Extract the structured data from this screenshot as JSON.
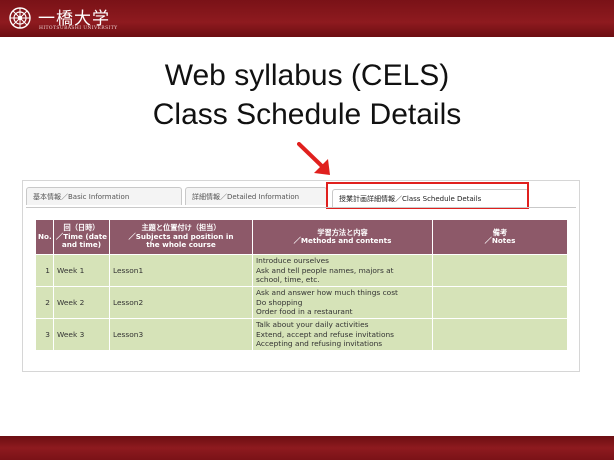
{
  "header": {
    "logo_jp": "一橋大学",
    "logo_en": "HITOTSUBASHI UNIVERSITY"
  },
  "title": {
    "line1": "Web syllabus (CELS)",
    "line2": "Class Schedule Details"
  },
  "tabs": [
    {
      "label": "基本情報／Basic Information",
      "active": false
    },
    {
      "label": "詳細情報／Detailed Information",
      "active": false
    },
    {
      "label": "授業計画詳細情報／Class Schedule Details",
      "active": true
    }
  ],
  "table": {
    "headers": {
      "no": "No.",
      "time": [
        "回（日時）",
        "／Time (date",
        "and time)"
      ],
      "subject": [
        "主題と位置付け（担当）",
        "／Subjects and position in",
        "the whole course"
      ],
      "methods": [
        "学習方法と内容",
        "／Methods and contents"
      ],
      "notes": [
        "備考",
        "／Notes"
      ]
    },
    "rows": [
      {
        "no": "1",
        "time": "Week 1",
        "subject": "Lesson1",
        "methods": [
          "Introduce ourselves",
          "Ask and tell people names, majors at",
          "school, time, etc."
        ],
        "notes": ""
      },
      {
        "no": "2",
        "time": "Week 2",
        "subject": "Lesson2",
        "methods": [
          "Ask and answer how much things cost",
          "Do shopping",
          "Order food in a restaurant"
        ],
        "notes": ""
      },
      {
        "no": "3",
        "time": "Week 3",
        "subject": "Lesson3",
        "methods": [
          "Talk about your daily activities",
          "Extend, accept and refuse invitations",
          "Accepting and refusing invitations"
        ],
        "notes": ""
      }
    ]
  },
  "colors": {
    "brand": "#8e1a1f",
    "header_cell": "#8d5969",
    "body_cell": "#d6e3b8",
    "highlight": "#e0201e"
  },
  "icons": {
    "arrow": "arrow-down-right-icon",
    "seal": "university-seal-icon"
  }
}
